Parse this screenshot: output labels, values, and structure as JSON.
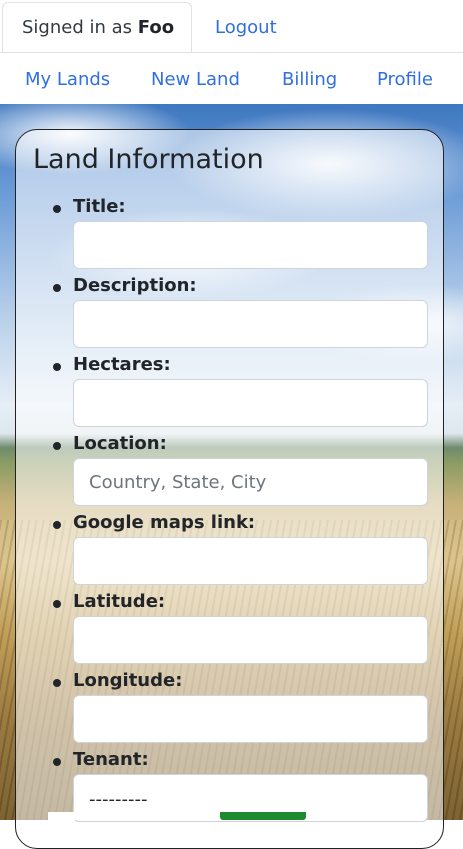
{
  "header": {
    "signed_prefix": "Signed in as",
    "username": "Foo",
    "logout_label": "Logout"
  },
  "nav": {
    "items": [
      "My Lands",
      "New Land",
      "Billing",
      "Profile"
    ]
  },
  "form": {
    "title": "Land Information",
    "fields": [
      {
        "label": "Title:",
        "value": "",
        "placeholder": ""
      },
      {
        "label": "Description:",
        "value": "",
        "placeholder": ""
      },
      {
        "label": "Hectares:",
        "value": "",
        "placeholder": ""
      },
      {
        "label": "Location:",
        "value": "",
        "placeholder": "Country, State, City"
      },
      {
        "label": "Google maps link:",
        "value": "",
        "placeholder": ""
      },
      {
        "label": "Latitude:",
        "value": "",
        "placeholder": ""
      },
      {
        "label": "Longitude:",
        "value": "",
        "placeholder": ""
      },
      {
        "label": "Tenant:",
        "selected": "---------"
      }
    ]
  },
  "colors": {
    "link": "#2f6fe0",
    "submit_green": "#1e8a2e"
  }
}
